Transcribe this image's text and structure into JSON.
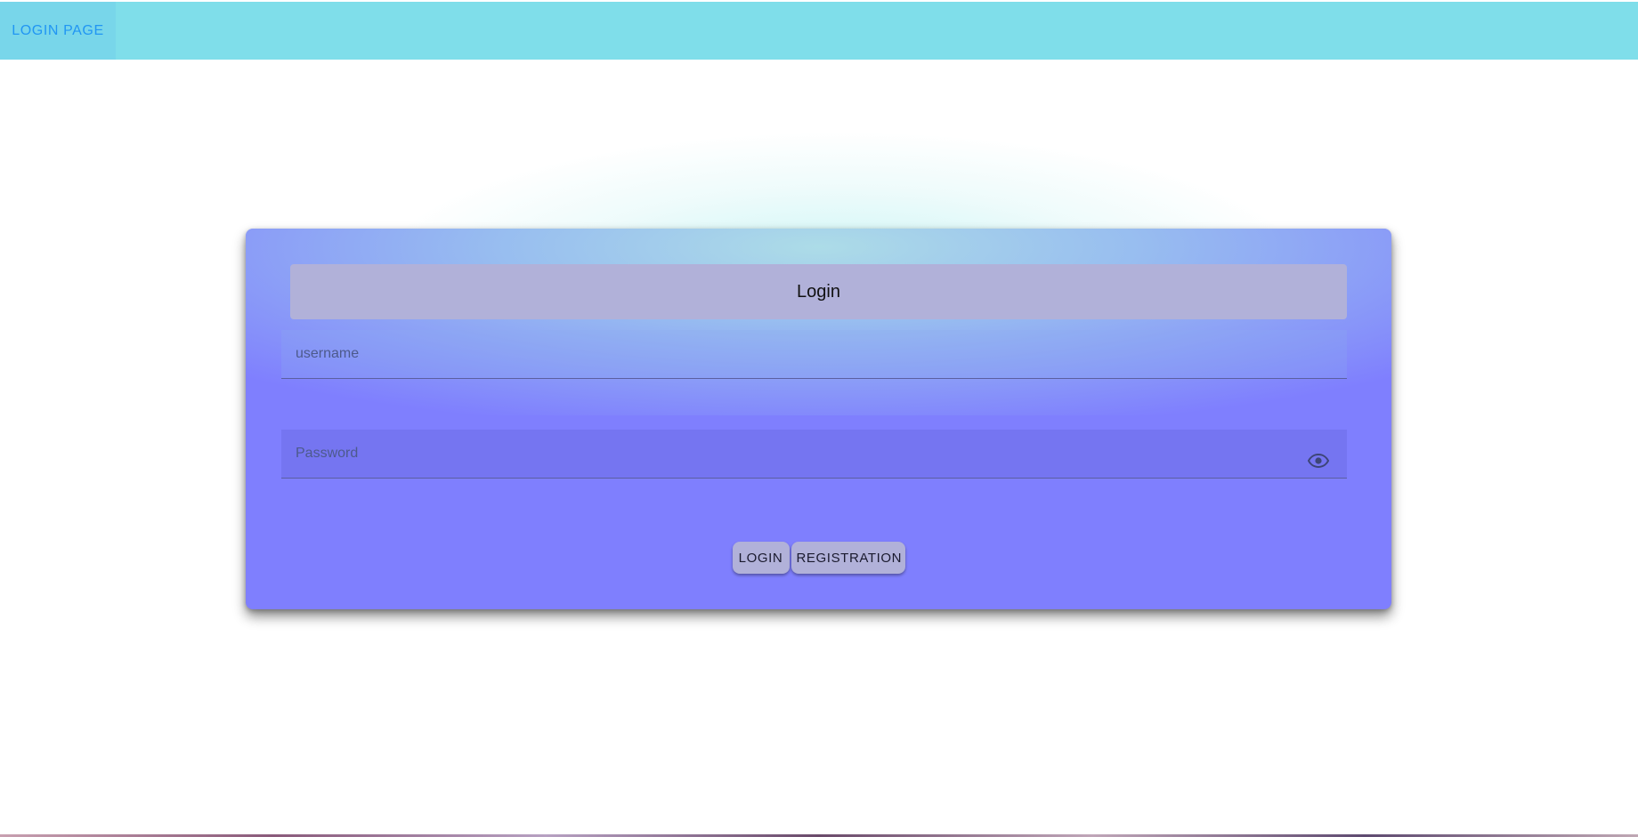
{
  "nav": {
    "tab_label": "Login Page"
  },
  "login_card": {
    "title": "Login",
    "username_placeholder": "username",
    "password_placeholder": "Password",
    "password_toggle_icon": "eye-icon",
    "login_button": "Login",
    "registration_button": "Registration"
  },
  "colors": {
    "topbar": "#7fdeea",
    "tab_text": "#2196f3",
    "card": "#7f7ffe",
    "title_bg": "#b1b1d9"
  }
}
